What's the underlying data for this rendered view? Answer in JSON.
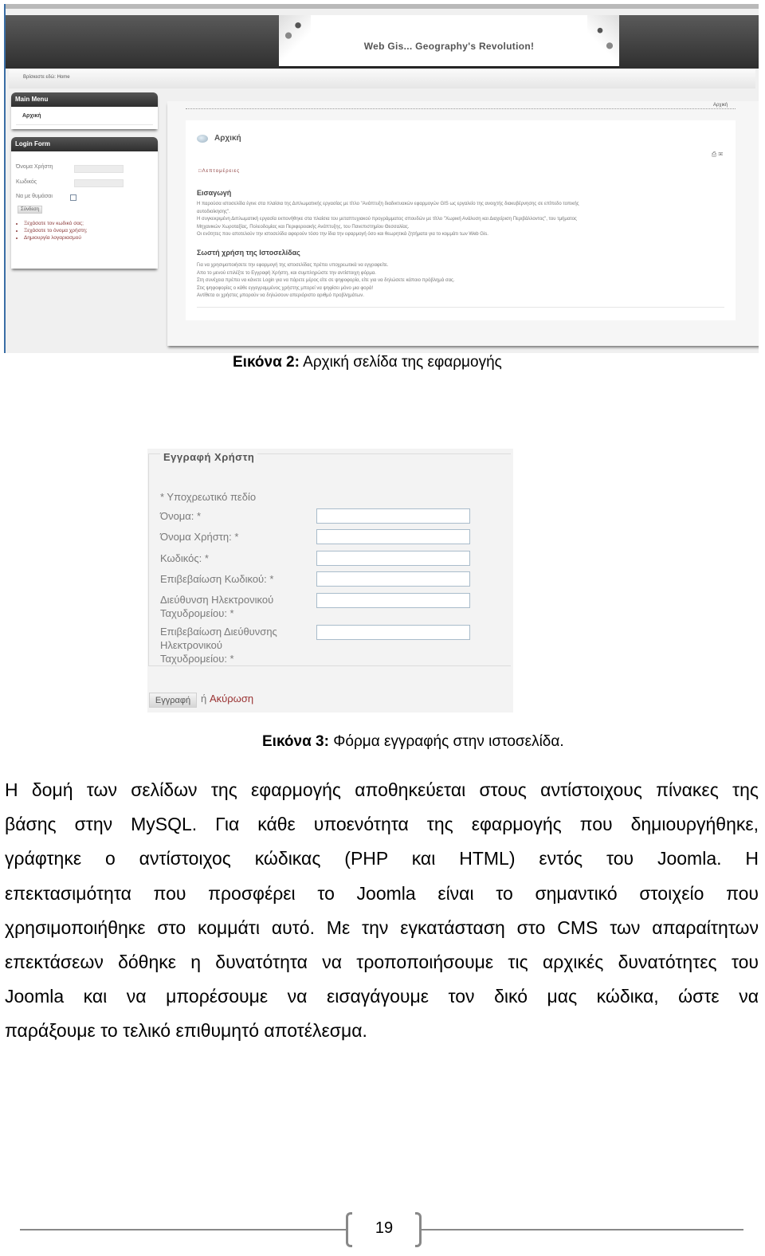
{
  "figure2": {
    "banner_title": "Web Gis... Geography's Revolution!",
    "breadcrumb": "Βρίσκεστε εδώ: Home",
    "breadcrumb_right": "Αρχική",
    "main_menu": {
      "title": "Main Menu",
      "items": [
        "Αρχική"
      ]
    },
    "login_form": {
      "title": "Login Form",
      "username_label": "Όνομα Χρήστη",
      "password_label": "Κωδικός",
      "remember_label": "Να με θυμάσαι",
      "submit_label": "Σύνδεση",
      "links": [
        "Ξεχάσατε τον κωδικό σας;",
        "Ξεχάσατε το όνομα χρήστη;",
        "Δημιουργία λογαριασμού"
      ]
    },
    "article": {
      "title": "Αρχική",
      "details_label": "Λεπτομέρειες",
      "print_icon": "printer-icon",
      "email_icon": "email-icon",
      "intro_heading": "Εισαγωγή",
      "intro_lines": [
        "Η παρούσα ιστοσελίδα έγινε στα πλαίσια της Διπλωματικής εργασίας με τίτλο \"Ανάπτυξη διαδικτυακών εφαρμογών GIS ως εργαλείο της ανοιχτής διακυβέρνησης σε επίπεδο τοπικής",
        "αυτοδιοίκησης\".",
        "Η συγκεκριμένη Διπλωματική εργασία εκπονήθηκε στα πλαίσια του μεταπτυχιακού προγράμματος σπουδών με τίτλο \"Χωρική Ανάλυση και Διαχείριση Περιβάλλοντος\", του τμήματος",
        "Μηχανικών Χωροταξίας, Πολεοδομίας και Περιφερειακής Ανάπτυξης, του Πανεπιστημίου Θεσσαλίας.",
        "Οι ενότητες που αποτελούν την ιστοσελίδα αφορούν τόσο την ίδια την εφαρμογή όσο και θεωρητικά ζητήματα για το κομμάτι των Web Gis."
      ],
      "usage_heading": "Σωστή χρήση της Ιστοσελίδας",
      "usage_lines": [
        "Για να χρησιμοποιήσετε την εφαρμογή της ιστοσελίδας πρέπει υποχρεωτικά να εγγραφείτε.",
        "Απο το μενού επιλέξτε το Εγγραφή Χρήστη, και συμπληρώστε την αντίστοιχη φόρμα.",
        "Στη συνέχεια πρέπει να κάνετε Login για να πάρετε μέρος είτε σε ψηφοφορία, είτε για να δηλώσετε κάποιο πρόβλημά σας.",
        "Στις ψηφοφορίες ο κάθε εγγεγραμμένος χρήστης μπορεί να ψηφίσει μόνο μια φορά!",
        "Αντίθετα οι χρήστες μπορούν να δηλώσουν απεριόριστο αριθμό προβλημάτων."
      ]
    }
  },
  "caption2": {
    "label": "Εικόνα 2:",
    "text": " Αρχική σελίδα της εφαρμογής"
  },
  "figure3": {
    "legend": "Εγγραφή Χρήστη",
    "required_note": "* Υποχρεωτικό πεδίο",
    "fields": [
      {
        "label": "Όνομα: *",
        "value": ""
      },
      {
        "label": "Όνομα Χρήστη: *",
        "value": ""
      },
      {
        "label": "Κωδικός: *",
        "value": ""
      },
      {
        "label": "Επιβεβαίωση Κωδικού: *",
        "value": ""
      },
      {
        "label_lines": [
          "Διεύθυνση Ηλεκτρονικού",
          "Ταχυδρομείου: *"
        ],
        "value": ""
      },
      {
        "label_lines": [
          "Επιβεβαίωση Διεύθυνσης",
          "Ηλεκτρονικού",
          "Ταχυδρομείου: *"
        ],
        "value": ""
      }
    ],
    "register_label": "Εγγραφή",
    "or_text": "ή",
    "cancel_label": "Ακύρωση"
  },
  "caption3": {
    "label": "Εικόνα 3:",
    "text": " Φόρμα εγγραφής στην ιστοσελίδα."
  },
  "paragraph_lines": [
    "Η δομή των σελίδων της εφαρμογής αποθηκεύεται στους αντίστοιχους πίνακες της",
    "βάσης στην MySQL. Για κάθε υποενότητα της εφαρμογής που δημιουργήθηκε,",
    "γράφτηκε ο αντίστοιχος κώδικας (PHP και HTML) εντός του Joomla. Η",
    "επεκτασιμότητα που προσφέρει το Joomla είναι το σημαντικό στοιχείο που",
    "χρησιμοποιήθηκε στο κομμάτι αυτό. Με την εγκατάσταση στο CMS των απαραίτητων",
    "επεκτάσεων δόθηκε η δυνατότητα να τροποποιήσουμε τις αρχικές δυνατότητες του",
    "Joomla και να μπορέσουμε να εισαγάγουμε τον δικό μας κώδικα, ώστε να",
    "παράξουμε το τελικό επιθυμητό αποτέλεσμα."
  ],
  "footer": {
    "page_number": "19"
  }
}
